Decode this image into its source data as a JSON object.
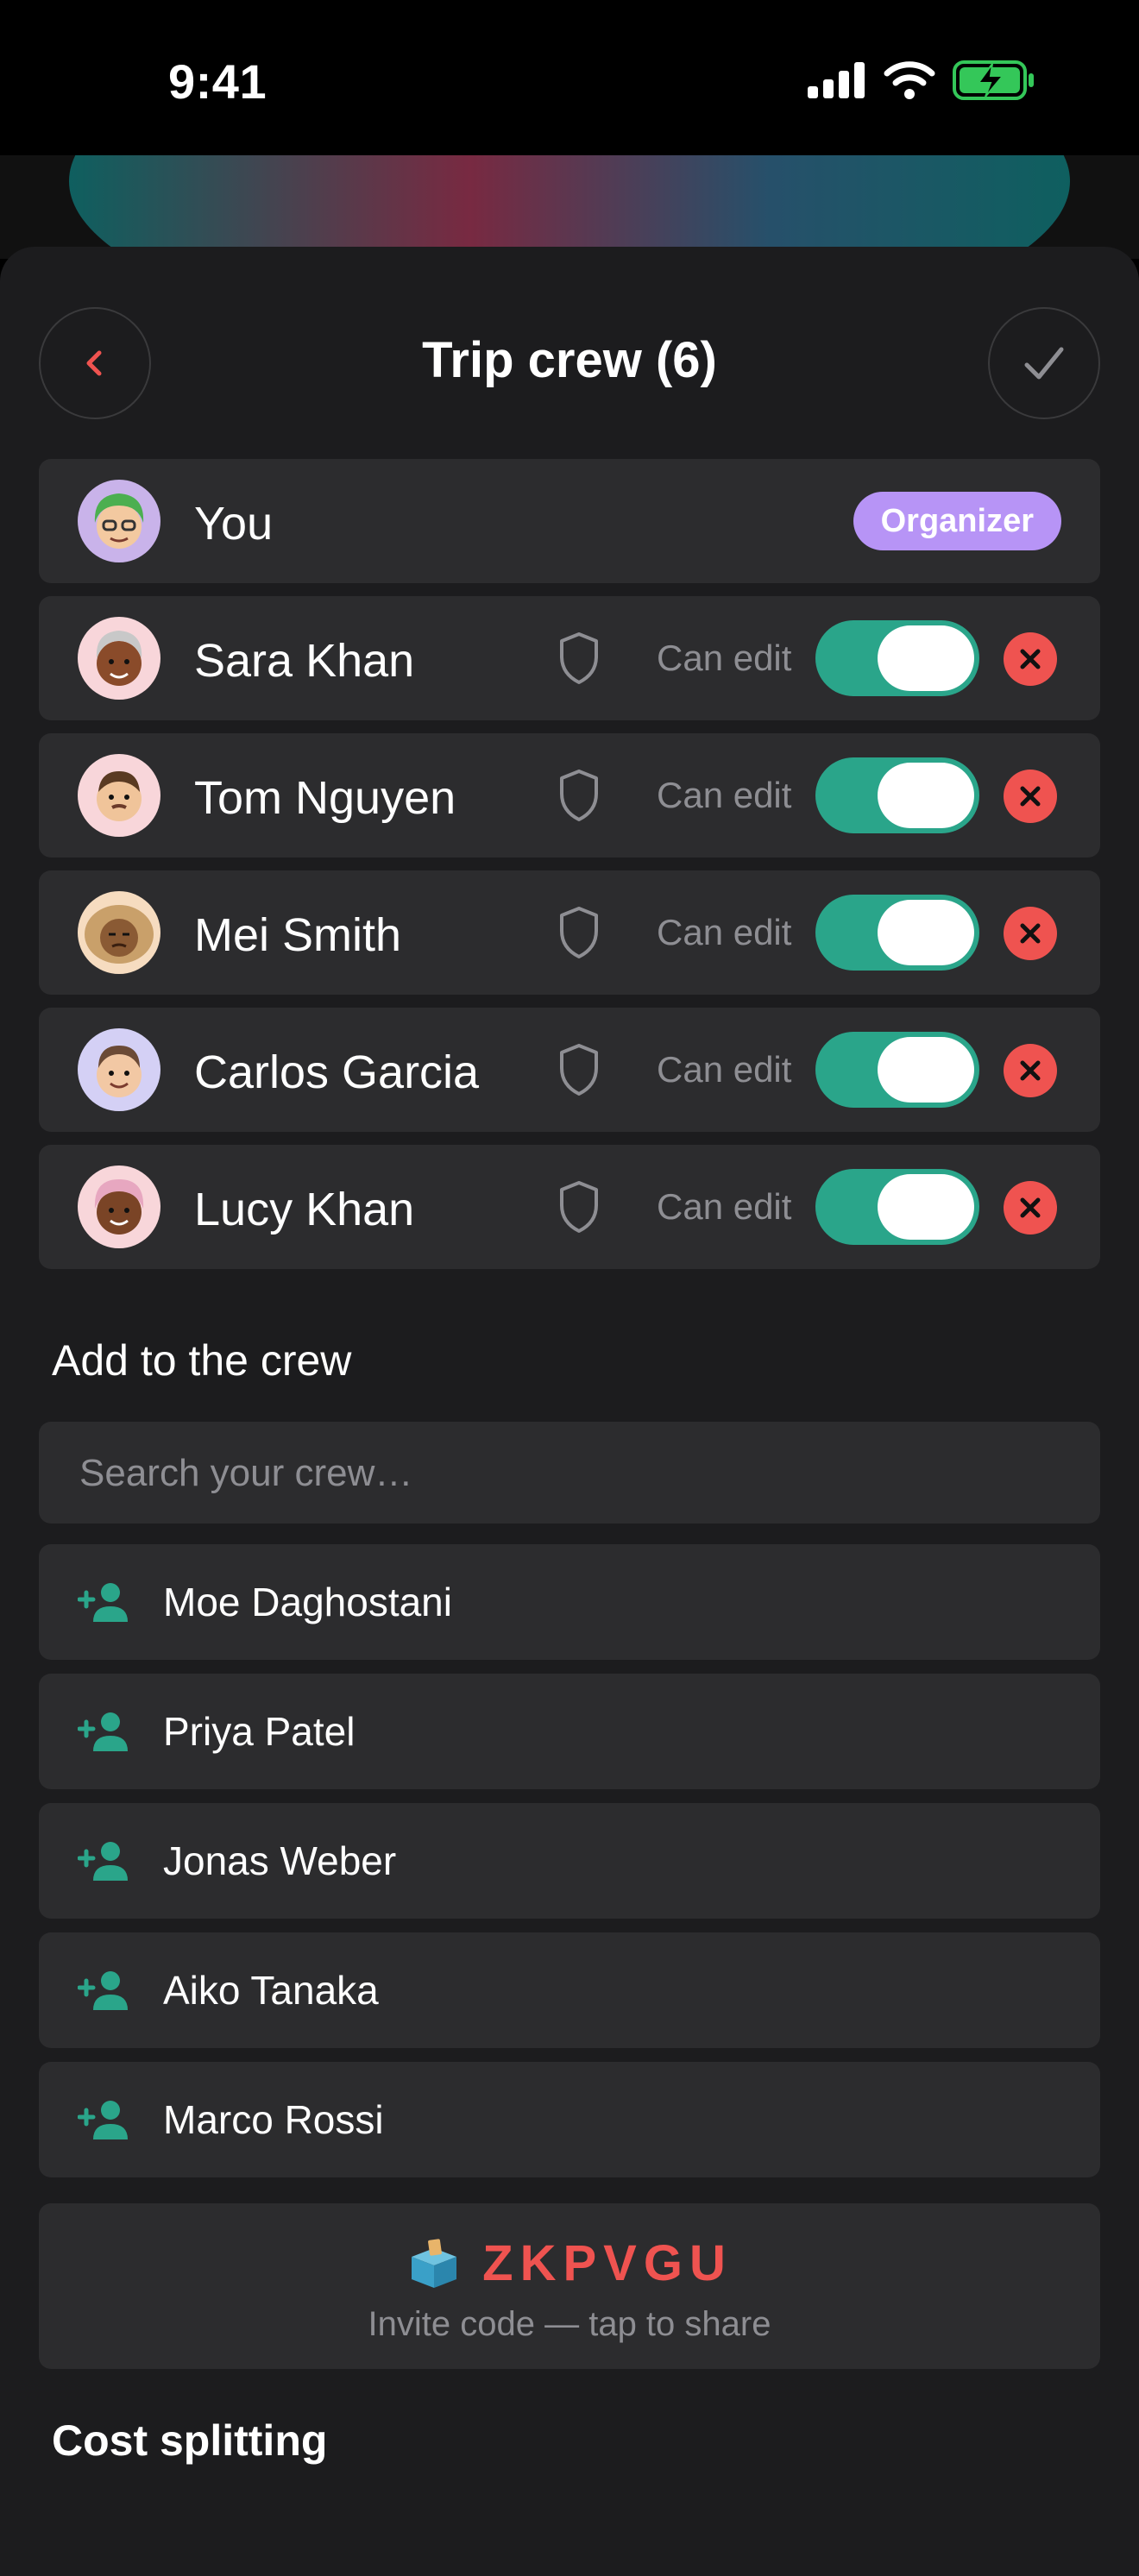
{
  "status_bar": {
    "time": "9:41"
  },
  "header": {
    "title": "Trip crew (6)"
  },
  "organizer": {
    "name": "You",
    "badge": "Organizer"
  },
  "members": [
    {
      "name": "Sara Khan",
      "permission_label": "Can edit",
      "can_edit": true
    },
    {
      "name": "Tom Nguyen",
      "permission_label": "Can edit",
      "can_edit": true
    },
    {
      "name": "Mei Smith",
      "permission_label": "Can edit",
      "can_edit": true
    },
    {
      "name": "Carlos Garcia",
      "permission_label": "Can edit",
      "can_edit": true
    },
    {
      "name": "Lucy Khan",
      "permission_label": "Can edit",
      "can_edit": true
    }
  ],
  "add_section": {
    "title": "Add to the crew",
    "search_placeholder": "Search your crew…",
    "candidates": [
      "Moe Daghostani",
      "Priya Patel",
      "Jonas Weber",
      "Aiko Tanaka",
      "Marco Rossi"
    ]
  },
  "invite": {
    "icon": "ballot-box",
    "code": "ZKPVGU",
    "hint": "Invite code — tap to share"
  },
  "cost_section": {
    "title": "Cost splitting"
  },
  "colors": {
    "accent_green": "#2aa58a",
    "remove_red": "#ef5350",
    "organizer_purple": "#b794f6",
    "code_red": "#ef5350"
  }
}
